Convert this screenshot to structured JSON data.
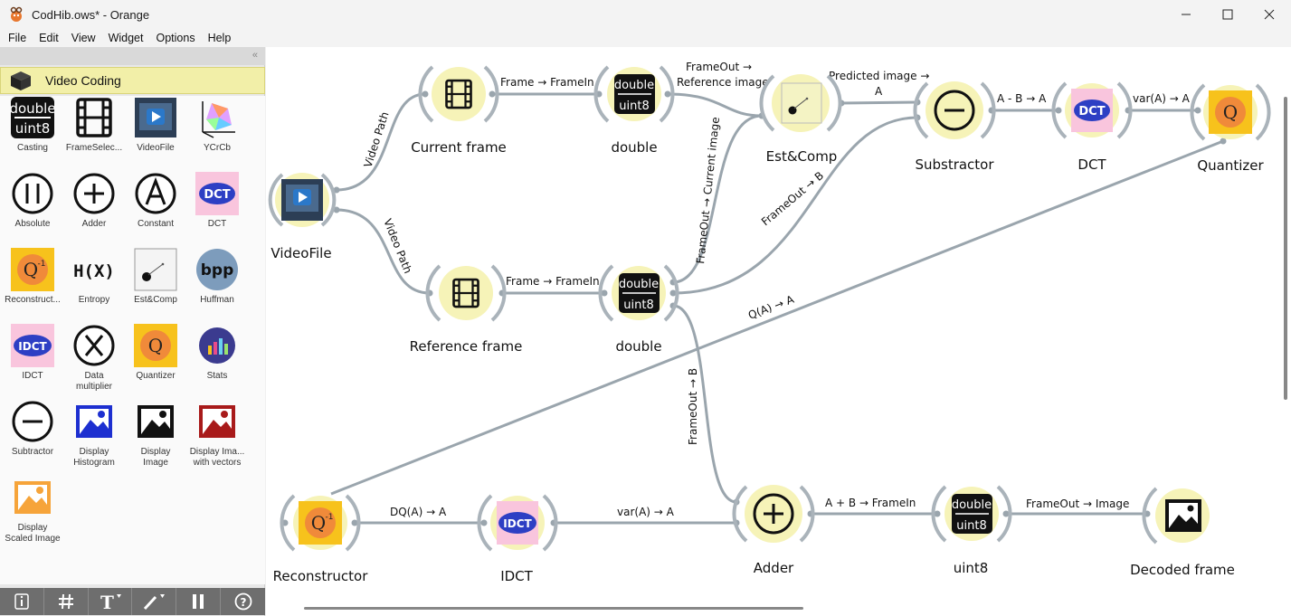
{
  "window": {
    "title": "CodHib.ows* - Orange",
    "icons": [
      "orange-app-icon",
      "minimize-icon",
      "maximize-icon",
      "close-icon"
    ]
  },
  "menu": [
    "File",
    "Edit",
    "View",
    "Widget",
    "Options",
    "Help"
  ],
  "sidebar": {
    "category": "Video Coding",
    "widgets": [
      {
        "label": "Casting",
        "icon": "double-uint8-icon"
      },
      {
        "label": "FrameSelec...",
        "icon": "film-icon"
      },
      {
        "label": "VideoFile",
        "icon": "video-file-icon"
      },
      {
        "label": "YCrCb",
        "icon": "color-space-icon"
      },
      {
        "label": "Absolute",
        "icon": "absolute-icon"
      },
      {
        "label": "Adder",
        "icon": "plus-icon"
      },
      {
        "label": "Constant",
        "icon": "constant-icon"
      },
      {
        "label": "DCT",
        "icon": "dct-icon"
      },
      {
        "label": "Reconstruct...",
        "icon": "reconstructor-icon"
      },
      {
        "label": "Entropy",
        "icon": "entropy-icon"
      },
      {
        "label": "Est&Comp",
        "icon": "estcomp-icon"
      },
      {
        "label": "Huffman",
        "icon": "huffman-icon"
      },
      {
        "label": "IDCT",
        "icon": "idct-icon"
      },
      {
        "label": "Data\nmultiplier",
        "icon": "multiply-icon"
      },
      {
        "label": "Quantizer",
        "icon": "quantizer-icon"
      },
      {
        "label": "Stats",
        "icon": "stats-icon"
      },
      {
        "label": "Subtractor",
        "icon": "minus-icon"
      },
      {
        "label": "Display\nHistogram",
        "icon": "display-histogram-icon"
      },
      {
        "label": "Display\nImage",
        "icon": "display-image-icon"
      },
      {
        "label": "Display Ima...\nwith vectors",
        "icon": "display-vectors-icon"
      },
      {
        "label": "Display\nScaled Image",
        "icon": "display-scaled-icon"
      }
    ],
    "toolbar": [
      "info-icon",
      "grid-icon",
      "text-annotation-icon",
      "arrow-annotation-icon",
      "pause-icon",
      "help-icon"
    ]
  },
  "canvas": {
    "nodes": {
      "videofile": "VideoFile",
      "current_frame": "Current frame",
      "reference_frame": "Reference frame",
      "double_top": "double",
      "double_bottom": "double",
      "estcomp": "Est&Comp",
      "substractor": "Substractor",
      "dct": "DCT",
      "quantizer": "Quantizer",
      "reconstructor": "Reconstructor",
      "idct": "IDCT",
      "adder": "Adder",
      "uint8": "uint8",
      "decoded": "Decoded frame"
    },
    "links": {
      "vp1": "Video Path",
      "vp2": "Video Path",
      "f1": "Frame → FrameIn",
      "f2": "Frame → FrameIn",
      "fo_ref_1": "FrameOut →",
      "fo_ref_2": "Reference image",
      "fo_cur": "FrameOut → Current image",
      "pred_1": "Predicted image →",
      "pred_2": "A",
      "fo_b": "FrameOut → B",
      "amb": "A - B → A",
      "var_top": "var(A) → A",
      "qa": "Q(A) → A",
      "fo_b2": "FrameOut → B",
      "dqa": "DQ(A) → A",
      "var_bottom": "var(A) → A",
      "apb": "A + B → FrameIn",
      "fo_img": "FrameOut → Image"
    },
    "icon_text": {
      "double": "double",
      "uint8": "uint8",
      "dct": "DCT",
      "idct": "IDCT",
      "q": "Q"
    }
  }
}
